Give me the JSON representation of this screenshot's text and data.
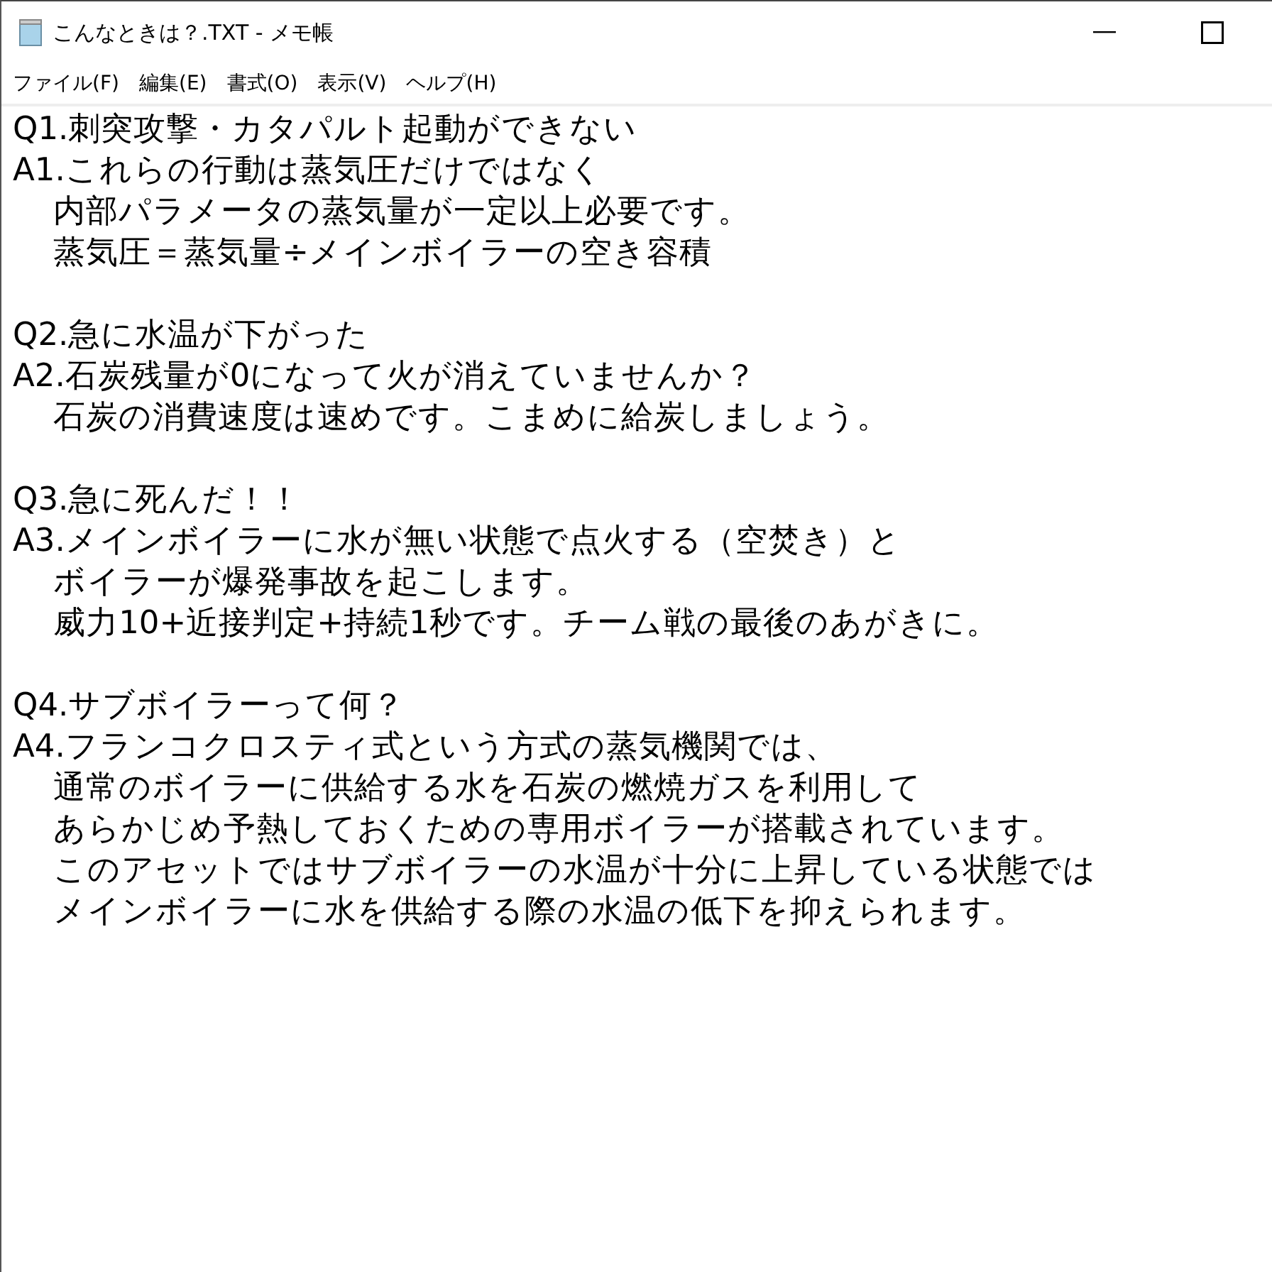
{
  "window": {
    "title": "こんなときは？.TXT - メモ帳"
  },
  "menu": [
    "ファイル(F)",
    "編集(E)",
    "書式(O)",
    "表示(V)",
    "ヘルプ(H)"
  ],
  "editor": {
    "blocks": [
      [
        "Q1.刺突攻撃・カタパルト起動ができない",
        "A1.これらの行動は蒸気圧だけではなく",
        "    内部パラメータの蒸気量が一定以上必要です。",
        "    蒸気圧＝蒸気量÷メインボイラーの空き容積"
      ],
      [
        "Q2.急に水温が下がった",
        "A2.石炭残量が0になって火が消えていませんか？",
        "    石炭の消費速度は速めです。こまめに給炭しましょう。"
      ],
      [
        "Q3.急に死んだ！！",
        "A3.メインボイラーに水が無い状態で点火する（空焚き）と",
        "    ボイラーが爆発事故を起こします。",
        "    威力10+近接判定+持続1秒です。チーム戦の最後のあがきに。"
      ],
      [
        "Q4.サブボイラーって何？",
        "A4.フランコクロスティ式という方式の蒸気機関では、",
        "    通常のボイラーに供給する水を石炭の燃焼ガスを利用して",
        "    あらかじめ予熱しておくための専用ボイラーが搭載されています。",
        "    このアセットではサブボイラーの水温が十分に上昇している状態では",
        "    メインボイラーに水を供給する際の水温の低下を抑えられます。"
      ]
    ]
  }
}
